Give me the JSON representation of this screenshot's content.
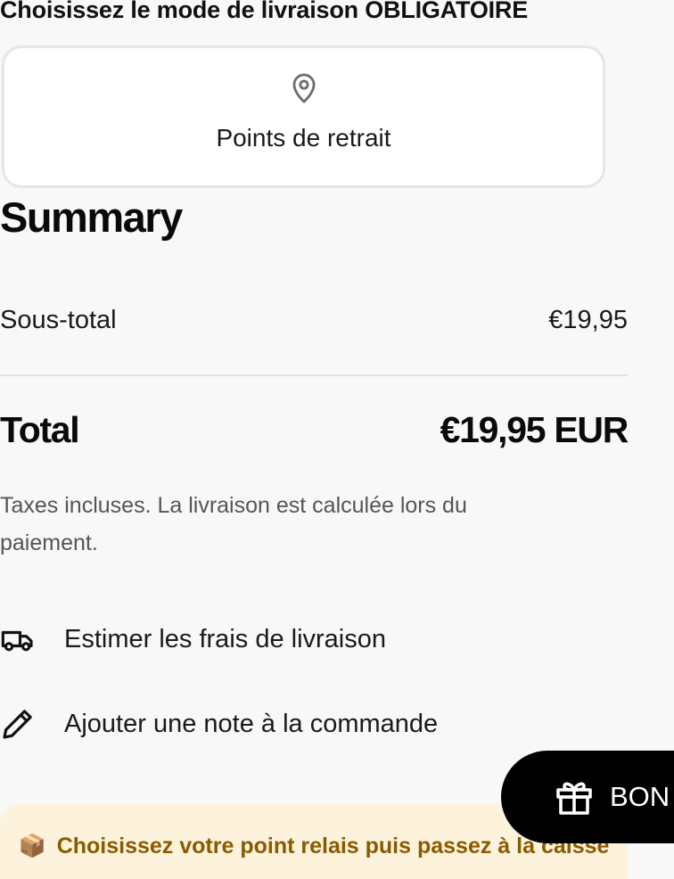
{
  "shipping": {
    "heading": "Choisissez le mode de livraison OBLIGATOIRE",
    "option_label": "Points de retrait",
    "option_icon": "map-pin-icon"
  },
  "summary": {
    "title": "Summary",
    "subtotal_label": "Sous-total",
    "subtotal_value": "€19,95",
    "total_label": "Total",
    "total_value": "€19,95 EUR",
    "tax_note": "Taxes incluses. La livraison est calculée lors du paiement."
  },
  "actions": {
    "estimate_label": "Estimer les frais de livraison",
    "estimate_icon": "truck-icon",
    "note_label": "Ajouter une note à la commande",
    "note_icon": "pencil-icon"
  },
  "promo": {
    "emoji": "📦",
    "text": "Choisissez votre point relais puis passez à la caisse"
  },
  "gift_button": {
    "label": "BON",
    "icon": "gift-icon"
  },
  "colors": {
    "background": "#f8f8f8",
    "promo_background": "#fdf3dc",
    "promo_text": "#8a5a00",
    "gift_button": "#000000"
  }
}
